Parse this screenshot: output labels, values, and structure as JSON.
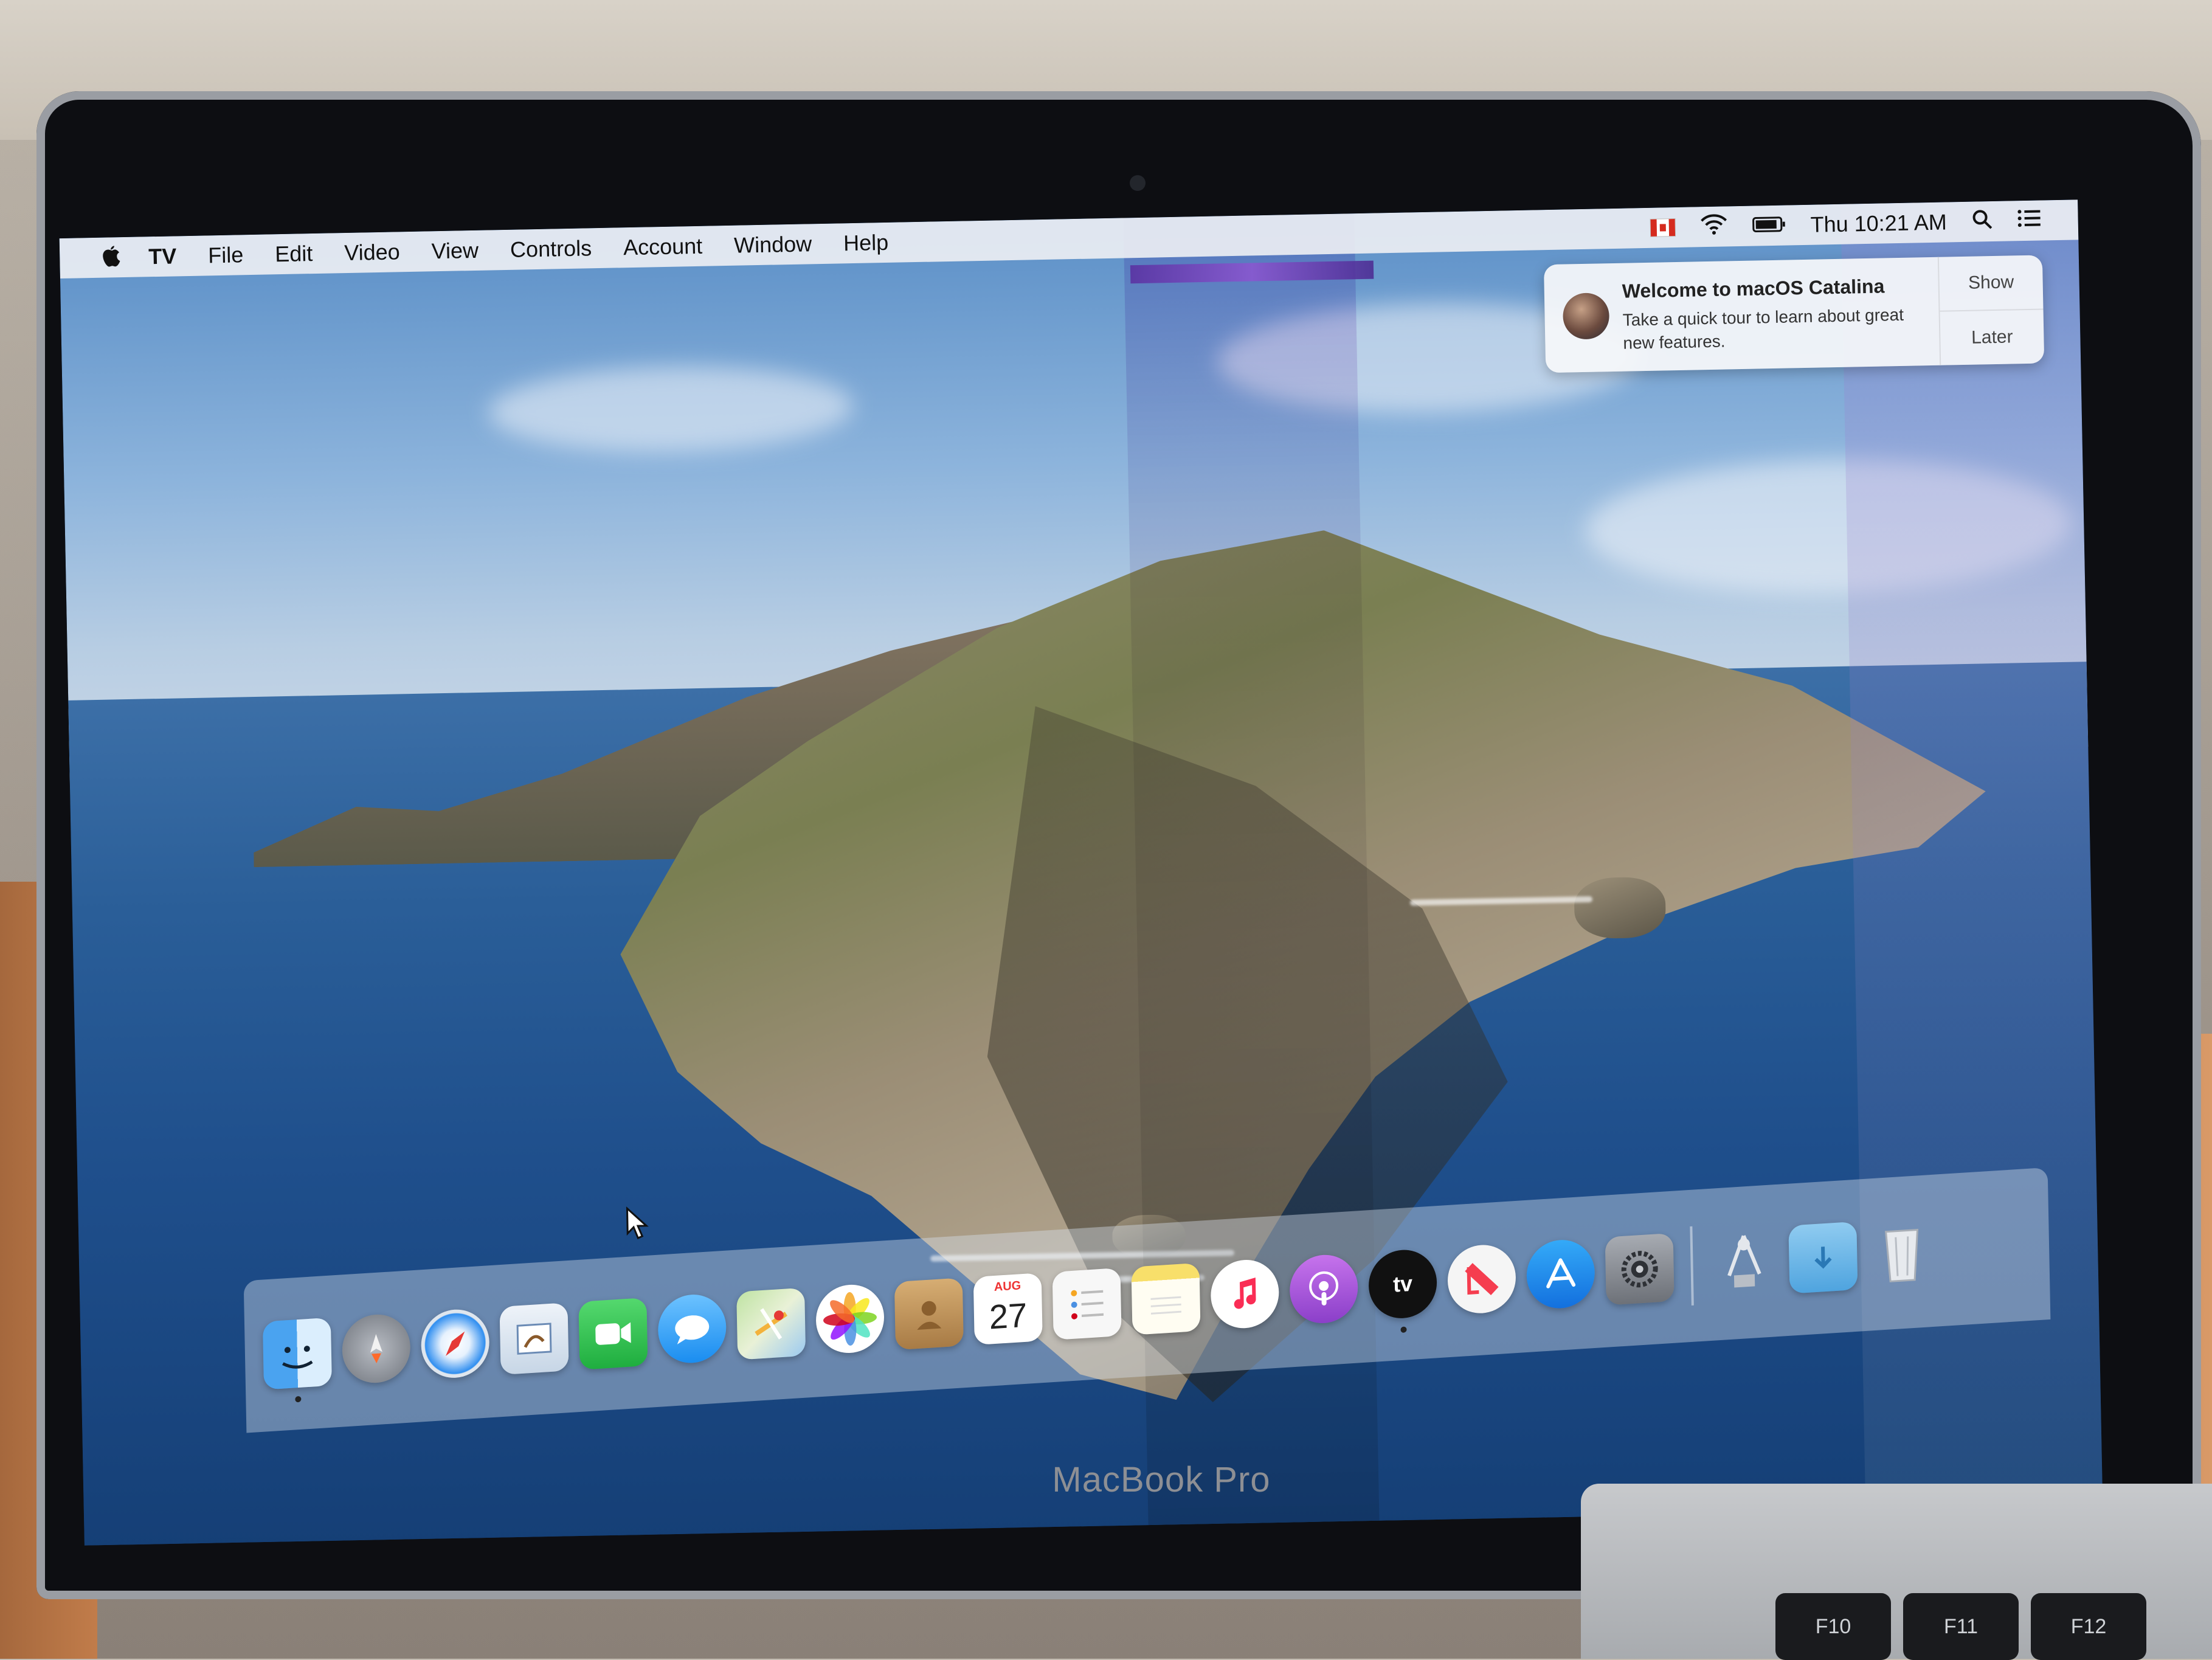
{
  "menubar": {
    "app_name": "TV",
    "menus": [
      "File",
      "Edit",
      "Video",
      "View",
      "Controls",
      "Account",
      "Window",
      "Help"
    ],
    "clock": "Thu 10:21 AM",
    "status_icons": [
      "flag-canada-icon",
      "wifi-icon",
      "battery-icon",
      "spotlight-search-icon",
      "notification-center-icon"
    ]
  },
  "notification": {
    "title": "Welcome to macOS Catalina",
    "body": "Take a quick tour to learn about great new features.",
    "show_label": "Show",
    "later_label": "Later"
  },
  "dock": {
    "apps": [
      {
        "name": "Finder",
        "icon": "finder-icon",
        "color": "#4aa3f0",
        "running": true
      },
      {
        "name": "Launchpad",
        "icon": "launchpad-icon",
        "color": "#8d929a"
      },
      {
        "name": "Safari",
        "icon": "safari-icon",
        "color": "#2f8ef0"
      },
      {
        "name": "Mail",
        "icon": "mail-icon",
        "color": "#d7e3f1"
      },
      {
        "name": "FaceTime",
        "icon": "facetime-icon",
        "color": "#34c759"
      },
      {
        "name": "Messages",
        "icon": "messages-icon",
        "color": "#3aa7f5"
      },
      {
        "name": "Maps",
        "icon": "maps-icon",
        "color": "#a8d48b"
      },
      {
        "name": "Photos",
        "icon": "photos-icon",
        "color": "#ffffff"
      },
      {
        "name": "Contacts",
        "icon": "contacts-icon",
        "color": "#c49a63"
      },
      {
        "name": "Calendar",
        "icon": "calendar-icon",
        "color": "#ffffff",
        "month": "AUG",
        "day": "27"
      },
      {
        "name": "Reminders",
        "icon": "reminders-icon",
        "color": "#f6f6f6"
      },
      {
        "name": "Notes",
        "icon": "notes-icon",
        "color": "#f7e07a"
      },
      {
        "name": "Music",
        "icon": "music-icon",
        "color": "#ffffff"
      },
      {
        "name": "Podcasts",
        "icon": "podcasts-icon",
        "color": "#a553d8"
      },
      {
        "name": "TV",
        "icon": "apple-tv-icon",
        "color": "#111111",
        "label": "tv",
        "running": true
      },
      {
        "name": "News",
        "icon": "news-icon",
        "color": "#f5f5f5"
      },
      {
        "name": "App Store",
        "icon": "app-store-icon",
        "color": "#1f8ef0"
      },
      {
        "name": "System Preferences",
        "icon": "system-preferences-icon",
        "color": "#8e9299"
      }
    ],
    "right": [
      {
        "name": "Install macOS Catalina",
        "icon": "installer-icon",
        "color": "#d9dde3"
      },
      {
        "name": "Downloads",
        "icon": "downloads-folder-icon",
        "color": "#6fb7e6"
      },
      {
        "name": "Trash",
        "icon": "trash-icon",
        "color": "#d7dbe0"
      }
    ]
  },
  "bezel": {
    "brand": "MacBook Pro"
  },
  "keys": [
    "F10",
    "F11",
    "F12"
  ]
}
